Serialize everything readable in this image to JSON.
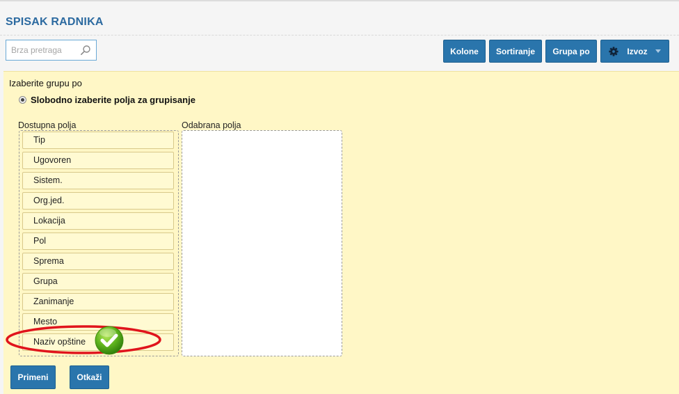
{
  "header": {
    "title": "SPISAK RADNIKA"
  },
  "search": {
    "placeholder": "Brza pretraga",
    "icon": "search-icon"
  },
  "toolbar": {
    "kolone_label": "Kolone",
    "sortiranje_label": "Sortiranje",
    "grupa_po_label": "Grupa po",
    "izvoz_label": "Izvoz",
    "izvoz_icon": "gear-icon",
    "button_color": "#2a75ac"
  },
  "group_panel": {
    "heading": "Izaberite grupu po",
    "background": "#fff7c6",
    "option": {
      "label": "Slobodno izaberite polja za grupisanje",
      "selected": true
    },
    "available_label": "Dostupna polja",
    "selected_label": "Odabrana polja",
    "available_fields": [
      "Tip",
      "Ugovoren",
      "Sistem.",
      "Org.jed.",
      "Lokacija",
      "Pol",
      "Sprema",
      "Grupa",
      "Zanimanje",
      "Mesto",
      "Naziv opštine"
    ],
    "selected_fields": []
  },
  "annotation": {
    "highlighted_field": "Naziv opštine",
    "highlight_color": "#e0141c",
    "check_icon": "check-icon"
  },
  "footer": {
    "apply_label": "Primeni",
    "cancel_label": "Otkaži"
  }
}
